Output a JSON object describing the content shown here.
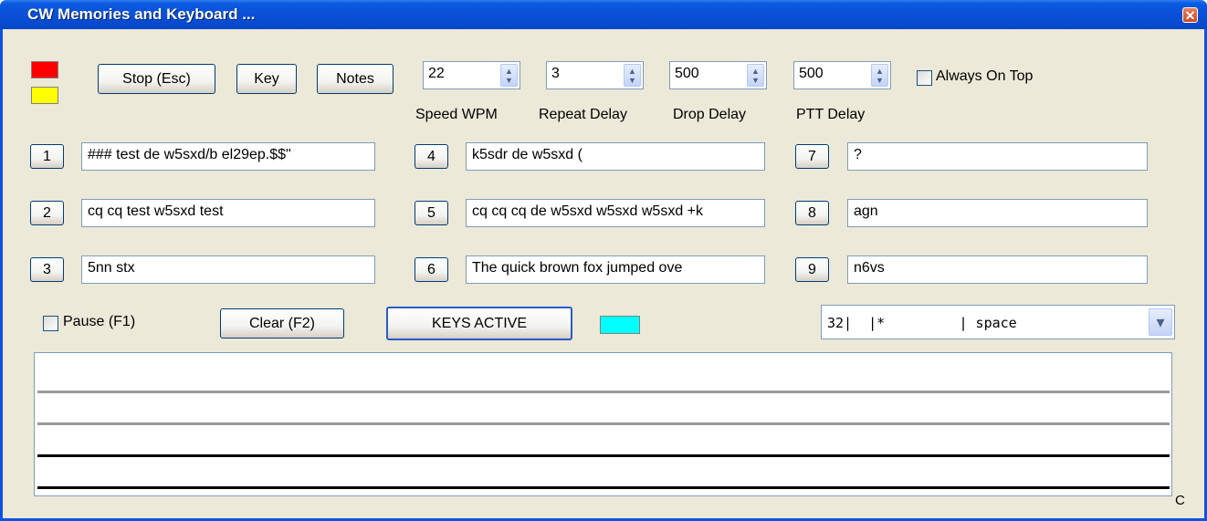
{
  "window": {
    "title": "CW Memories and Keyboard ...",
    "close_glyph": "✕"
  },
  "indicators": {
    "tx_color": "#FF0000",
    "ptt_color": "#FFFF00",
    "keys_color": "#00FFFF"
  },
  "toolbar": {
    "stop_label": "Stop (Esc)",
    "key_label": "Key",
    "notes_label": "Notes"
  },
  "settings": {
    "speed": {
      "value": "22",
      "label": "Speed WPM"
    },
    "repeat": {
      "value": "3",
      "label": "Repeat Delay"
    },
    "drop": {
      "value": "500",
      "label": "Drop Delay"
    },
    "ptt": {
      "value": "500",
      "label": "PTT Delay"
    },
    "always_on_top_label": "Always On Top"
  },
  "memories": [
    {
      "key": "1",
      "text": "### test de w5sxd/b el29ep.$$\""
    },
    {
      "key": "2",
      "text": "cq cq test w5sxd test"
    },
    {
      "key": "3",
      "text": "5nn stx"
    },
    {
      "key": "4",
      "text": "k5sdr de w5sxd ("
    },
    {
      "key": "5",
      "text": "cq cq cq de w5sxd w5sxd w5sxd +k"
    },
    {
      "key": "6",
      "text": "The quick brown fox jumped ove"
    },
    {
      "key": "7",
      "text": "?"
    },
    {
      "key": "8",
      "text": "agn"
    },
    {
      "key": "9",
      "text": "n6vs"
    }
  ],
  "controls": {
    "pause_label": "Pause (F1)",
    "clear_label": "Clear (F2)",
    "keys_active_label": "KEYS ACTIVE",
    "char_select_value": "32|  |*         | space",
    "dropdown_glyph": "▾"
  },
  "corner_label": "C"
}
